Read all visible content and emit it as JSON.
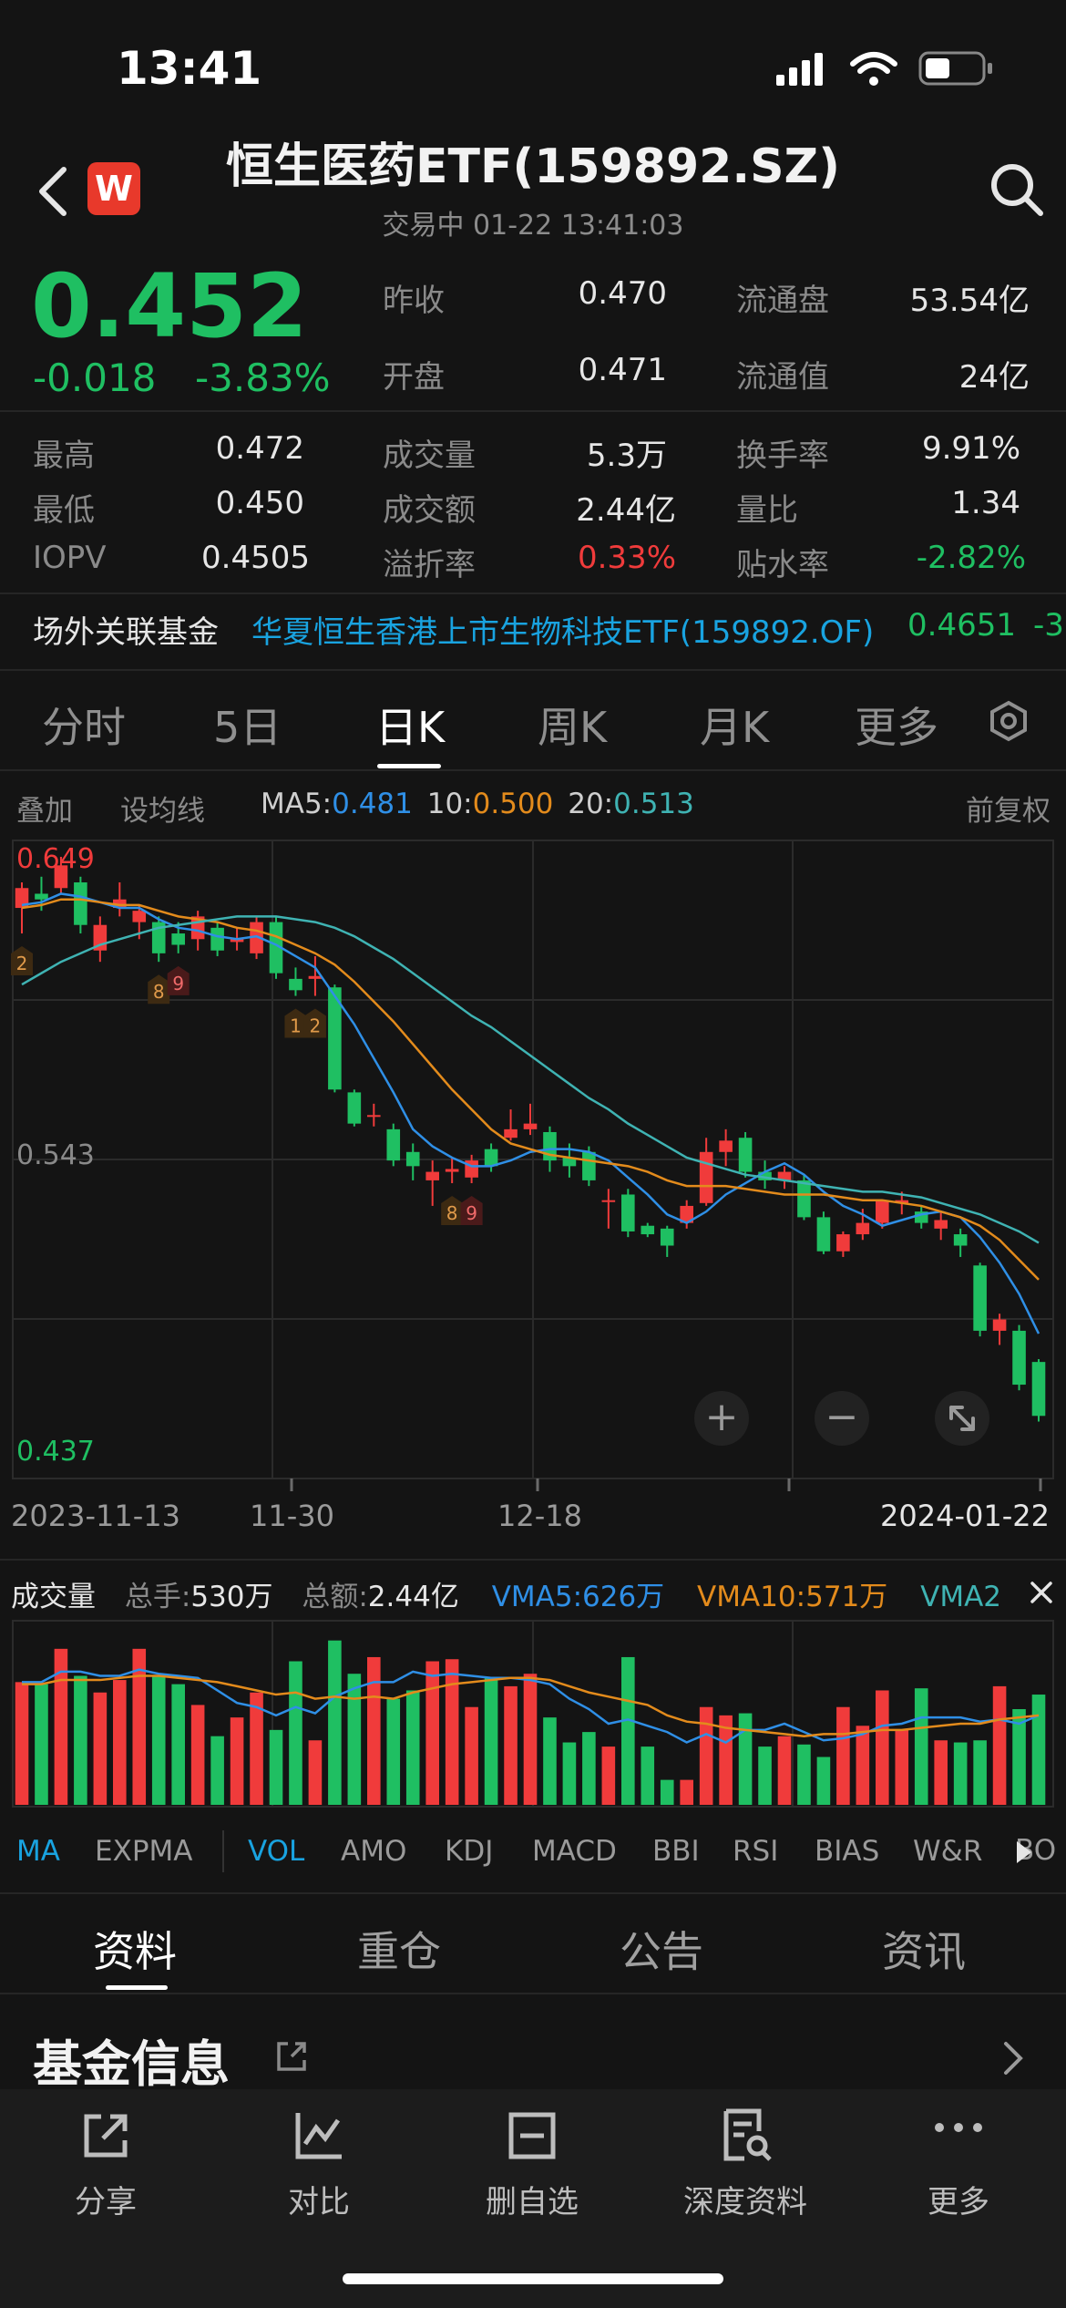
{
  "status": {
    "time": "13:41"
  },
  "header": {
    "title": "恒生医药ETF(159892.SZ)",
    "subtitle": "交易中 01-22 13:41:03",
    "logo_letter": "W"
  },
  "quote": {
    "price": "0.452",
    "change": "-0.018",
    "change_pct": "-3.83%",
    "prev_close_label": "昨收",
    "prev_close": "0.470",
    "open_label": "开盘",
    "open": "0.471",
    "float_shares_label": "流通盘",
    "float_shares": "53.54亿",
    "float_value_label": "流通值",
    "float_value": "24亿",
    "high_label": "最高",
    "high": "0.472",
    "low_label": "最低",
    "low": "0.450",
    "iopv_label": "IOPV",
    "iopv": "0.4505",
    "volume_label": "成交量",
    "volume": "5.3万",
    "amount_label": "成交额",
    "amount": "2.44亿",
    "premium_label": "溢折率",
    "premium": "0.33%",
    "turnover_label": "换手率",
    "turnover": "9.91%",
    "vol_ratio_label": "量比",
    "vol_ratio": "1.34",
    "discount_label": "贴水率",
    "discount": "-2.82%"
  },
  "related": {
    "label": "场外关联基金",
    "fund": "华夏恒生香港上市生物科技ETF(159892.OF)",
    "price": "0.4651",
    "change": "-3"
  },
  "tabs": [
    "分时",
    "5日",
    "日K",
    "周K",
    "月K",
    "更多"
  ],
  "active_tab": "日K",
  "chart_toolbar": {
    "overlay": "叠加",
    "set_ma": "设均线",
    "ma5_label": "MA5:",
    "ma5": "0.481",
    "ma10_label": "10:",
    "ma10": "0.500",
    "ma20_label": "20:",
    "ma20": "0.513",
    "adjust": "前复权"
  },
  "chart_data": {
    "type": "candlestick",
    "price_labels": {
      "high": "0.649",
      "mid": "0.543",
      "low": "0.437"
    },
    "ylim": [
      0.437,
      0.649
    ],
    "date_labels": [
      "2023-11-13",
      "11-30",
      "12-18",
      "2024-01-22"
    ],
    "candles": [
      {
        "o": 0.631,
        "h": 0.64,
        "l": 0.622,
        "c": 0.638
      },
      {
        "o": 0.636,
        "h": 0.642,
        "l": 0.63,
        "c": 0.634
      },
      {
        "o": 0.638,
        "h": 0.649,
        "l": 0.636,
        "c": 0.646
      },
      {
        "o": 0.64,
        "h": 0.642,
        "l": 0.622,
        "c": 0.625
      },
      {
        "o": 0.616,
        "h": 0.628,
        "l": 0.612,
        "c": 0.625
      },
      {
        "o": 0.631,
        "h": 0.64,
        "l": 0.628,
        "c": 0.634
      },
      {
        "o": 0.626,
        "h": 0.632,
        "l": 0.62,
        "c": 0.63
      },
      {
        "o": 0.626,
        "h": 0.628,
        "l": 0.612,
        "c": 0.615
      },
      {
        "o": 0.622,
        "h": 0.626,
        "l": 0.615,
        "c": 0.618
      },
      {
        "o": 0.62,
        "h": 0.63,
        "l": 0.616,
        "c": 0.628
      },
      {
        "o": 0.624,
        "h": 0.626,
        "l": 0.614,
        "c": 0.616
      },
      {
        "o": 0.619,
        "h": 0.624,
        "l": 0.616,
        "c": 0.62
      },
      {
        "o": 0.615,
        "h": 0.628,
        "l": 0.613,
        "c": 0.626
      },
      {
        "o": 0.626,
        "h": 0.628,
        "l": 0.606,
        "c": 0.608
      },
      {
        "o": 0.606,
        "h": 0.61,
        "l": 0.6,
        "c": 0.602
      },
      {
        "o": 0.606,
        "h": 0.614,
        "l": 0.6,
        "c": 0.607
      },
      {
        "o": 0.603,
        "h": 0.604,
        "l": 0.566,
        "c": 0.567
      },
      {
        "o": 0.566,
        "h": 0.567,
        "l": 0.554,
        "c": 0.555
      },
      {
        "o": 0.558,
        "h": 0.562,
        "l": 0.554,
        "c": 0.558
      },
      {
        "o": 0.553,
        "h": 0.555,
        "l": 0.54,
        "c": 0.542
      },
      {
        "o": 0.545,
        "h": 0.548,
        "l": 0.535,
        "c": 0.54
      },
      {
        "o": 0.535,
        "h": 0.542,
        "l": 0.526,
        "c": 0.538
      },
      {
        "o": 0.538,
        "h": 0.543,
        "l": 0.534,
        "c": 0.539
      },
      {
        "o": 0.536,
        "h": 0.544,
        "l": 0.534,
        "c": 0.542
      },
      {
        "o": 0.546,
        "h": 0.548,
        "l": 0.538,
        "c": 0.54
      },
      {
        "o": 0.55,
        "h": 0.56,
        "l": 0.549,
        "c": 0.553
      },
      {
        "o": 0.553,
        "h": 0.562,
        "l": 0.551,
        "c": 0.555
      },
      {
        "o": 0.552,
        "h": 0.554,
        "l": 0.538,
        "c": 0.542
      },
      {
        "o": 0.543,
        "h": 0.548,
        "l": 0.536,
        "c": 0.54
      },
      {
        "o": 0.545,
        "h": 0.547,
        "l": 0.533,
        "c": 0.535
      },
      {
        "o": 0.528,
        "h": 0.532,
        "l": 0.518,
        "c": 0.528
      },
      {
        "o": 0.53,
        "h": 0.532,
        "l": 0.515,
        "c": 0.517
      },
      {
        "o": 0.519,
        "h": 0.52,
        "l": 0.515,
        "c": 0.516
      },
      {
        "o": 0.518,
        "h": 0.519,
        "l": 0.508,
        "c": 0.512
      },
      {
        "o": 0.52,
        "h": 0.528,
        "l": 0.518,
        "c": 0.526
      },
      {
        "o": 0.527,
        "h": 0.55,
        "l": 0.526,
        "c": 0.545
      },
      {
        "o": 0.545,
        "h": 0.553,
        "l": 0.54,
        "c": 0.549
      },
      {
        "o": 0.55,
        "h": 0.552,
        "l": 0.536,
        "c": 0.538
      },
      {
        "o": 0.538,
        "h": 0.542,
        "l": 0.532,
        "c": 0.535
      },
      {
        "o": 0.535,
        "h": 0.54,
        "l": 0.532,
        "c": 0.538
      },
      {
        "o": 0.535,
        "h": 0.537,
        "l": 0.521,
        "c": 0.522
      },
      {
        "o": 0.522,
        "h": 0.524,
        "l": 0.509,
        "c": 0.51
      },
      {
        "o": 0.51,
        "h": 0.517,
        "l": 0.508,
        "c": 0.516
      },
      {
        "o": 0.516,
        "h": 0.525,
        "l": 0.514,
        "c": 0.52
      },
      {
        "o": 0.52,
        "h": 0.528,
        "l": 0.518,
        "c": 0.528
      },
      {
        "o": 0.527,
        "h": 0.531,
        "l": 0.523,
        "c": 0.528
      },
      {
        "o": 0.524,
        "h": 0.526,
        "l": 0.518,
        "c": 0.52
      },
      {
        "o": 0.518,
        "h": 0.524,
        "l": 0.514,
        "c": 0.521
      },
      {
        "o": 0.516,
        "h": 0.518,
        "l": 0.508,
        "c": 0.512
      },
      {
        "o": 0.505,
        "h": 0.506,
        "l": 0.48,
        "c": 0.482
      },
      {
        "o": 0.482,
        "h": 0.488,
        "l": 0.477,
        "c": 0.486
      },
      {
        "o": 0.482,
        "h": 0.484,
        "l": 0.461,
        "c": 0.463
      },
      {
        "o": 0.471,
        "h": 0.472,
        "l": 0.45,
        "c": 0.452
      }
    ],
    "ma5": [
      0.632,
      0.633,
      0.636,
      0.635,
      0.633,
      0.631,
      0.631,
      0.627,
      0.624,
      0.623,
      0.621,
      0.62,
      0.621,
      0.618,
      0.614,
      0.61,
      0.6,
      0.59,
      0.578,
      0.566,
      0.553,
      0.547,
      0.543,
      0.54,
      0.54,
      0.542,
      0.545,
      0.546,
      0.546,
      0.545,
      0.542,
      0.536,
      0.53,
      0.523,
      0.52,
      0.524,
      0.53,
      0.534,
      0.538,
      0.541,
      0.537,
      0.531,
      0.526,
      0.523,
      0.519,
      0.521,
      0.523,
      0.524,
      0.522,
      0.515,
      0.506,
      0.495,
      0.481
    ],
    "ma10": [
      0.631,
      0.632,
      0.634,
      0.634,
      0.633,
      0.632,
      0.632,
      0.63,
      0.628,
      0.627,
      0.626,
      0.624,
      0.623,
      0.621,
      0.618,
      0.615,
      0.611,
      0.605,
      0.598,
      0.591,
      0.583,
      0.575,
      0.567,
      0.56,
      0.553,
      0.548,
      0.546,
      0.544,
      0.543,
      0.542,
      0.541,
      0.54,
      0.538,
      0.535,
      0.533,
      0.533,
      0.533,
      0.532,
      0.531,
      0.53,
      0.53,
      0.53,
      0.529,
      0.528,
      0.528,
      0.527,
      0.526,
      0.524,
      0.522,
      0.519,
      0.514,
      0.507,
      0.5
    ],
    "ma20": [
      0.604,
      0.608,
      0.612,
      0.615,
      0.618,
      0.62,
      0.622,
      0.624,
      0.625,
      0.626,
      0.627,
      0.628,
      0.628,
      0.628,
      0.627,
      0.626,
      0.624,
      0.621,
      0.617,
      0.613,
      0.608,
      0.603,
      0.598,
      0.593,
      0.589,
      0.584,
      0.579,
      0.574,
      0.569,
      0.564,
      0.56,
      0.555,
      0.551,
      0.547,
      0.543,
      0.541,
      0.539,
      0.537,
      0.536,
      0.535,
      0.534,
      0.533,
      0.532,
      0.531,
      0.531,
      0.53,
      0.529,
      0.527,
      0.525,
      0.523,
      0.52,
      0.517,
      0.513
    ],
    "markers": [
      {
        "i": 0,
        "text": "2",
        "pos": "below"
      },
      {
        "i": 7,
        "text": "8",
        "pos": "below"
      },
      {
        "i": 8,
        "text": "9",
        "pos": "below",
        "red": true
      },
      {
        "i": 14,
        "text": "1",
        "pos": "below"
      },
      {
        "i": 15,
        "text": "2",
        "pos": "below"
      },
      {
        "i": 22,
        "text": "8",
        "pos": "below"
      },
      {
        "i": 23,
        "text": "9",
        "pos": "below",
        "red": true
      }
    ],
    "volume": [
      5.9,
      5.8,
      7.5,
      6.2,
      5.4,
      6.0,
      7.5,
      6.2,
      5.8,
      4.8,
      3.3,
      4.2,
      5.4,
      3.6,
      6.9,
      3.1,
      7.9,
      6.3,
      7.1,
      5.1,
      5.5,
      6.9,
      7.0,
      4.7,
      6.1,
      5.7,
      6.3,
      4.2,
      3.0,
      3.5,
      2.8,
      7.1,
      2.8,
      1.2,
      1.2,
      4.7,
      4.3,
      4.4,
      2.8,
      3.3,
      2.9,
      2.3,
      4.7,
      3.8,
      5.5,
      3.6,
      5.6,
      3.1,
      3.0,
      3.1,
      5.7,
      4.6,
      5.3
    ],
    "vma5": [
      5.9,
      5.9,
      6.4,
      6.4,
      6.2,
      6.2,
      6.5,
      6.3,
      6.2,
      6.1,
      5.5,
      4.9,
      4.7,
      4.3,
      4.7,
      4.4,
      5.2,
      5.6,
      5.9,
      5.9,
      6.4,
      6.2,
      6.3,
      6.2,
      6.1,
      6.1,
      6.0,
      5.8,
      5.1,
      4.6,
      3.9,
      4.1,
      3.8,
      3.5,
      3.0,
      3.4,
      3.0,
      3.6,
      3.6,
      3.9,
      3.5,
      3.1,
      3.2,
      3.4,
      3.8,
      3.9,
      4.2,
      4.2,
      4.2,
      4.0,
      4.1,
      3.9,
      4.3
    ],
    "vma10": [
      5.8,
      5.8,
      6.0,
      6.0,
      6.0,
      6.1,
      6.2,
      6.2,
      6.1,
      6.0,
      5.9,
      5.7,
      5.5,
      5.3,
      5.4,
      5.1,
      5.2,
      5.1,
      5.2,
      5.1,
      5.4,
      5.6,
      5.8,
      5.9,
      6.0,
      6.1,
      6.1,
      6.0,
      5.7,
      5.4,
      5.2,
      5.0,
      4.8,
      4.3,
      4.0,
      3.9,
      3.7,
      3.6,
      3.5,
      3.4,
      3.3,
      3.4,
      3.4,
      3.5,
      3.6,
      3.6,
      3.7,
      3.8,
      3.9,
      3.9,
      4.1,
      4.2,
      4.3
    ],
    "vol_max": 8.5
  },
  "chart_controls": {
    "zoom_in": "+",
    "zoom_out": "−"
  },
  "volume_bar": {
    "label": "成交量",
    "hands_label": "总手:",
    "hands": "530万",
    "amount_label": "总额:",
    "amount": "2.44亿",
    "vma5_label": "VMA5:",
    "vma5": "626万",
    "vma10_label": "VMA10:",
    "vma10": "571万",
    "vma20_label": "VMA2"
  },
  "indicators": [
    "MA",
    "EXPMA",
    "VOL",
    "AMO",
    "KDJ",
    "MACD",
    "BBI",
    "RSI",
    "BIAS",
    "W&R",
    "BO"
  ],
  "bottom_tabs": [
    "资料",
    "重仓",
    "公告",
    "资讯"
  ],
  "fund_info": {
    "title": "基金信息"
  },
  "bottom_nav": [
    {
      "label": "分享"
    },
    {
      "label": "对比"
    },
    {
      "label": "删自选"
    },
    {
      "label": "深度资料"
    },
    {
      "label": "更多"
    }
  ],
  "colors": {
    "up": "#f03b3b",
    "down": "#1fbf62",
    "ma5": "#2f8fe6",
    "ma10": "#e38b1c",
    "ma20": "#3fb3b3",
    "accent_blue": "#19a3e0"
  }
}
